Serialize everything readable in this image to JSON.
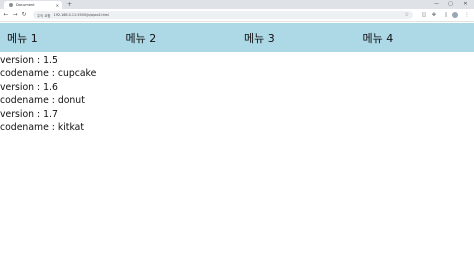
{
  "browser": {
    "tab_title": "Document",
    "new_tab": "+",
    "address_secure_label": "주의 요함",
    "url": "192.168.0.11:5500/js/ajax4.html",
    "window_controls": [
      "—",
      "▢",
      "✕"
    ]
  },
  "menu": {
    "items": [
      {
        "label": "메뉴 1"
      },
      {
        "label": "메뉴 2"
      },
      {
        "label": "메뉴 3"
      },
      {
        "label": "메뉴 4"
      }
    ],
    "background": "#add8e6"
  },
  "content": {
    "lines": [
      "version : 1.5",
      "codename : cupcake",
      "version : 1.6",
      "codename : donut",
      "version : 1.7",
      "codename : kitkat"
    ]
  }
}
